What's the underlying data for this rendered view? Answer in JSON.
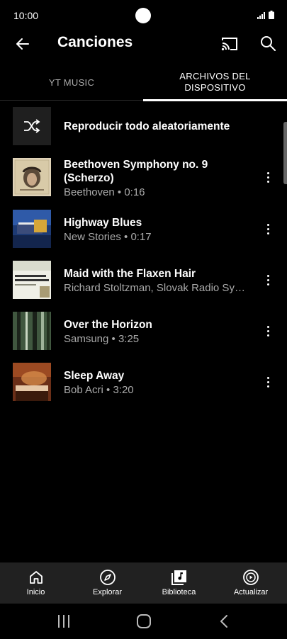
{
  "status": {
    "time": "10:00"
  },
  "header": {
    "title": "Canciones"
  },
  "tabs": [
    {
      "label": "YT MUSIC",
      "active": false
    },
    {
      "label": "ARCHIVOS DEL DISPOSITIVO",
      "active": true
    }
  ],
  "shuffle": {
    "label": "Reproducir todo aleatoriamente"
  },
  "songs": [
    {
      "title": "Beethoven Symphony no. 9 (Scherzo)",
      "subtitle": "Beethoven • 0:16",
      "art": "beethoven-album-art"
    },
    {
      "title": "Highway Blues",
      "subtitle": "New Stories • 0:17",
      "art": "highway-blues-album-art"
    },
    {
      "title": "Maid with the Flaxen Hair",
      "subtitle": "Richard Stoltzman, Slovak Radio Sy…",
      "art": "richard-stoltzman-album-art"
    },
    {
      "title": "Over the Horizon",
      "subtitle": "Samsung • 3:25",
      "art": "forest-album-art"
    },
    {
      "title": "Sleep Away",
      "subtitle": "Bob Acri • 3:20",
      "art": "piano-album-art"
    }
  ],
  "bottom_nav": [
    {
      "label": "Inicio",
      "icon": "home-icon"
    },
    {
      "label": "Explorar",
      "icon": "compass-icon"
    },
    {
      "label": "Biblioteca",
      "icon": "library-icon"
    },
    {
      "label": "Actualizar",
      "icon": "upgrade-icon"
    }
  ],
  "colors": {
    "background": "#000000",
    "nav_background": "#212121",
    "secondary_text": "#aaaaaa"
  }
}
